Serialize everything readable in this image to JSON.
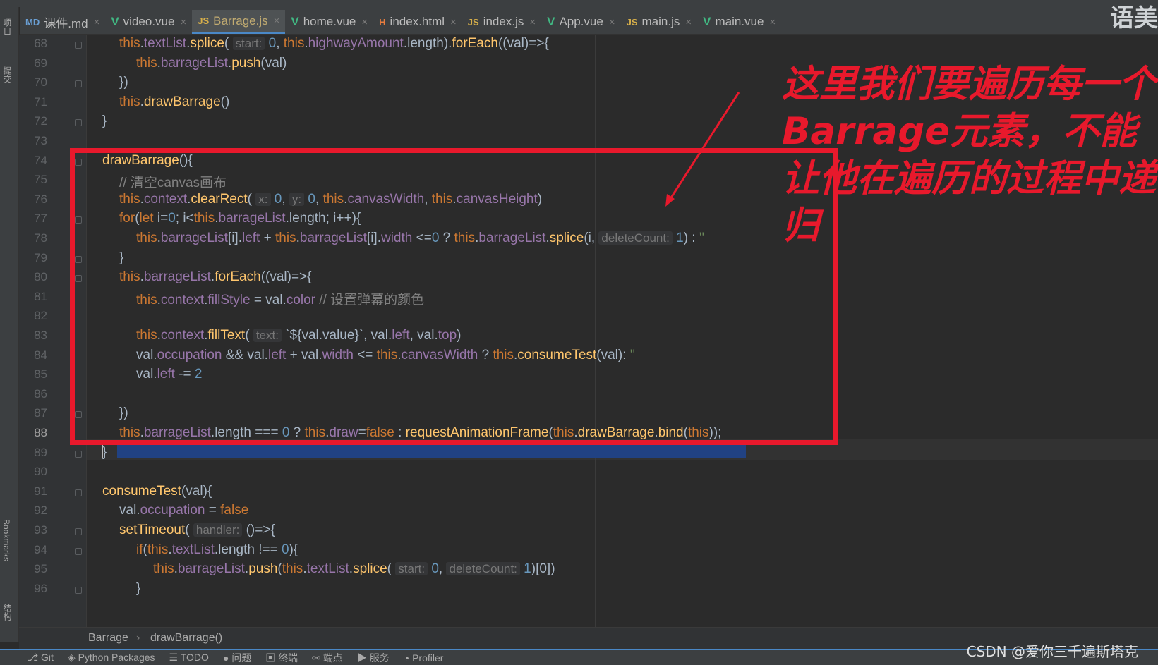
{
  "tabs": [
    {
      "icon": "MD",
      "label": "课件.md",
      "kind": "md"
    },
    {
      "icon": "V",
      "label": "video.vue",
      "kind": "vue"
    },
    {
      "icon": "JS",
      "label": "Barrage.js",
      "kind": "js",
      "active": true
    },
    {
      "icon": "V",
      "label": "home.vue",
      "kind": "vue"
    },
    {
      "icon": "H",
      "label": "index.html",
      "kind": "html"
    },
    {
      "icon": "JS",
      "label": "index.js",
      "kind": "js"
    },
    {
      "icon": "V",
      "label": "App.vue",
      "kind": "vue"
    },
    {
      "icon": "JS",
      "label": "main.js",
      "kind": "js"
    },
    {
      "icon": "V",
      "label": "main.vue",
      "kind": "vue"
    }
  ],
  "tab_close_glyph": "×",
  "corner_text": "语美",
  "left_tools": [
    "项目",
    "提交",
    "Bookmarks",
    "结构"
  ],
  "line_numbers": [
    "68",
    "69",
    "70",
    "71",
    "72",
    "73",
    "74",
    "75",
    "76",
    "77",
    "78",
    "79",
    "80",
    "81",
    "82",
    "83",
    "84",
    "85",
    "86",
    "87",
    "88",
    "89",
    "90",
    "91",
    "92",
    "93",
    "94",
    "95",
    "96"
  ],
  "current_line": "88",
  "code": {
    "l68": [
      [
        "kw",
        "this"
      ],
      [
        "",
        "."
      ],
      [
        "prop",
        "textList"
      ],
      [
        "",
        "."
      ],
      [
        "fn",
        "splice"
      ],
      [
        "",
        "( "
      ],
      [
        "hint",
        "start:"
      ],
      [
        "num",
        " 0"
      ],
      [
        "",
        ", "
      ],
      [
        "kw",
        "this"
      ],
      [
        "",
        "."
      ],
      [
        "prop",
        "highwayAmount"
      ],
      [
        "",
        ".length)."
      ],
      [
        "fn",
        "forEach"
      ],
      [
        "",
        "((val)=>{"
      ]
    ],
    "l69": [
      [
        "kw",
        "this"
      ],
      [
        "",
        "."
      ],
      [
        "prop",
        "barrageList"
      ],
      [
        "",
        "."
      ],
      [
        "fn",
        "push"
      ],
      [
        "",
        "(val)"
      ]
    ],
    "l70": [
      [
        "",
        "})"
      ]
    ],
    "l71": [
      [
        "kw",
        "this"
      ],
      [
        "",
        "."
      ],
      [
        "fn",
        "drawBarrage"
      ],
      [
        "",
        "()"
      ]
    ],
    "l72": [
      [
        "",
        "}"
      ]
    ],
    "l74": [
      [
        "fn",
        "drawBarrage"
      ],
      [
        "",
        "(){"
      ]
    ],
    "l75": [
      [
        "cmt",
        "// 清空canvas画布"
      ]
    ],
    "l76": [
      [
        "kw",
        "this"
      ],
      [
        "",
        "."
      ],
      [
        "prop",
        "context"
      ],
      [
        "",
        "."
      ],
      [
        "fn",
        "clearRect"
      ],
      [
        "",
        "( "
      ],
      [
        "hint",
        "x:"
      ],
      [
        "num",
        " 0"
      ],
      [
        "",
        ", "
      ],
      [
        "hint",
        "y:"
      ],
      [
        "num",
        " 0"
      ],
      [
        "",
        ", "
      ],
      [
        "kw",
        "this"
      ],
      [
        "",
        "."
      ],
      [
        "prop",
        "canvasWidth"
      ],
      [
        "",
        ", "
      ],
      [
        "kw",
        "this"
      ],
      [
        "",
        "."
      ],
      [
        "prop",
        "canvasHeight"
      ],
      [
        "",
        ")"
      ]
    ],
    "l77": [
      [
        "kw",
        "for"
      ],
      [
        "",
        "("
      ],
      [
        "kw",
        "let"
      ],
      [
        "",
        "",
        " i="
      ],
      [
        "num",
        "0"
      ],
      [
        "",
        "; i<"
      ],
      [
        "kw",
        "this"
      ],
      [
        "",
        "."
      ],
      [
        "prop",
        "barrageList"
      ],
      [
        "",
        ".length; i++){"
      ]
    ],
    "l78": [
      [
        "kw",
        "this"
      ],
      [
        "",
        "."
      ],
      [
        "prop",
        "barrageList"
      ],
      [
        "",
        "[i]."
      ],
      [
        "prop",
        "left"
      ],
      [
        "",
        " + "
      ],
      [
        "kw",
        "this"
      ],
      [
        "",
        "."
      ],
      [
        "prop",
        "barrageList"
      ],
      [
        "",
        "[i]."
      ],
      [
        "prop",
        "width"
      ],
      [
        "",
        " <="
      ],
      [
        "num",
        "0"
      ],
      [
        "",
        " ? "
      ],
      [
        "kw",
        "this"
      ],
      [
        "",
        "."
      ],
      [
        "prop",
        "barrageList"
      ],
      [
        "",
        "."
      ],
      [
        "fn",
        "splice"
      ],
      [
        "",
        "(i, "
      ],
      [
        "hint",
        "deleteCount:"
      ],
      [
        "num",
        " 1"
      ],
      [
        "",
        ") : "
      ],
      [
        "str",
        "''"
      ]
    ],
    "l79": [
      [
        "",
        "}"
      ]
    ],
    "l80": [
      [
        "kw",
        "this"
      ],
      [
        "",
        "."
      ],
      [
        "prop",
        "barrageList"
      ],
      [
        "",
        "."
      ],
      [
        "fn",
        "forEach"
      ],
      [
        "",
        "((val)=>{"
      ]
    ],
    "l81": [
      [
        "kw",
        "this"
      ],
      [
        "",
        "."
      ],
      [
        "prop",
        "context"
      ],
      [
        "",
        "."
      ],
      [
        "prop",
        "fillStyle"
      ],
      [
        "",
        " = val."
      ],
      [
        "prop",
        "color"
      ],
      [
        "",
        "",
        " "
      ],
      [
        "cmt",
        "// 设置弹幕的颜色"
      ]
    ],
    "l83": [
      [
        "kw",
        "this"
      ],
      [
        "",
        "."
      ],
      [
        "prop",
        "context"
      ],
      [
        "",
        "."
      ],
      [
        "fn",
        "fillText"
      ],
      [
        "",
        "( "
      ],
      [
        "hint",
        "text:"
      ],
      [
        "",
        " `${val.value}`, val."
      ],
      [
        "prop",
        "left"
      ],
      [
        "",
        ", val."
      ],
      [
        "prop",
        "top"
      ],
      [
        "",
        ")"
      ]
    ],
    "l84": [
      [
        "",
        "val."
      ],
      [
        "prop",
        "occupation"
      ],
      [
        "",
        " && val."
      ],
      [
        "prop",
        "left"
      ],
      [
        "",
        " + val."
      ],
      [
        "prop",
        "width"
      ],
      [
        "",
        " <= "
      ],
      [
        "kw",
        "this"
      ],
      [
        "",
        "."
      ],
      [
        "prop",
        "canvasWidth"
      ],
      [
        "",
        " ? "
      ],
      [
        "kw",
        "this"
      ],
      [
        "",
        "."
      ],
      [
        "fn",
        "consumeTest"
      ],
      [
        "",
        "(val): "
      ],
      [
        "str",
        "''"
      ]
    ],
    "l85": [
      [
        "",
        "val."
      ],
      [
        "prop",
        "left"
      ],
      [
        "",
        " -= "
      ],
      [
        "num",
        "2"
      ]
    ],
    "l87": [
      [
        "",
        "})"
      ]
    ],
    "l88": [
      [
        "kw",
        "this"
      ],
      [
        "",
        "."
      ],
      [
        "prop",
        "barrageList"
      ],
      [
        "",
        ".length === "
      ],
      [
        "num",
        "0"
      ],
      [
        "",
        " ? "
      ],
      [
        "kw",
        "this"
      ],
      [
        "",
        "."
      ],
      [
        "prop",
        "draw"
      ],
      [
        "",
        "="
      ],
      [
        "kw",
        "false"
      ],
      [
        "",
        " : "
      ],
      [
        "fn",
        "requestAnimationFrame"
      ],
      [
        "",
        "("
      ],
      [
        "kw",
        "this"
      ],
      [
        "",
        "."
      ],
      [
        "fn",
        "drawBarrage"
      ],
      [
        "",
        "."
      ],
      [
        "fn",
        "bind"
      ],
      [
        "",
        "("
      ],
      [
        "kw",
        "this"
      ],
      [
        "",
        "));"
      ]
    ],
    "l89": [
      [
        "",
        "}"
      ]
    ],
    "l91": [
      [
        "fn",
        "consumeTest"
      ],
      [
        "",
        "(val){"
      ]
    ],
    "l92": [
      [
        "",
        "val."
      ],
      [
        "prop",
        "occupation"
      ],
      [
        "",
        " = "
      ],
      [
        "kw",
        "false"
      ]
    ],
    "l93": [
      [
        "fn",
        "setTimeout"
      ],
      [
        "",
        "( "
      ],
      [
        "hint",
        "handler:"
      ],
      [
        "",
        " ()=>{"
      ]
    ],
    "l94": [
      [
        "kw",
        "if"
      ],
      [
        "",
        "("
      ],
      [
        "kw",
        "this"
      ],
      [
        "",
        "."
      ],
      [
        "prop",
        "textList"
      ],
      [
        "",
        ".length !== "
      ],
      [
        "num",
        "0"
      ],
      [
        "",
        "){"
      ]
    ],
    "l95": [
      [
        "kw",
        "this"
      ],
      [
        "",
        "."
      ],
      [
        "prop",
        "barrageList"
      ],
      [
        "",
        "."
      ],
      [
        "fn",
        "push"
      ],
      [
        "",
        "("
      ],
      [
        "kw",
        "this"
      ],
      [
        "",
        "."
      ],
      [
        "prop",
        "textList"
      ],
      [
        "",
        "."
      ],
      [
        "fn",
        "splice"
      ],
      [
        "",
        "( "
      ],
      [
        "hint",
        "start:"
      ],
      [
        "num",
        " 0"
      ],
      [
        "",
        ", "
      ],
      [
        "hint",
        "deleteCount:"
      ],
      [
        "num",
        " 1"
      ],
      [
        "",
        ")[0])"
      ]
    ],
    "l96": [
      [
        "",
        "}"
      ]
    ]
  },
  "annotation": "这里我们要遍历每一个Barrage元素，不能让他在遍历的过程中递归",
  "breadcrumb": [
    "Barrage",
    "drawBarrage()"
  ],
  "breadcrumb_sep": "›",
  "status_items": [
    "Git",
    "Python Packages",
    "TODO",
    "问题",
    "终端",
    "端点",
    "服务",
    "Profiler"
  ],
  "watermark": "CSDN @爱你三千遍斯塔克",
  "colors": {
    "accent": "#4a88c7",
    "annotation_red": "#e8192c",
    "keyword": "#cc7832",
    "function": "#ffc66d",
    "property": "#9876aa",
    "number": "#6897bb",
    "string": "#6a8759",
    "comment": "#808080"
  }
}
